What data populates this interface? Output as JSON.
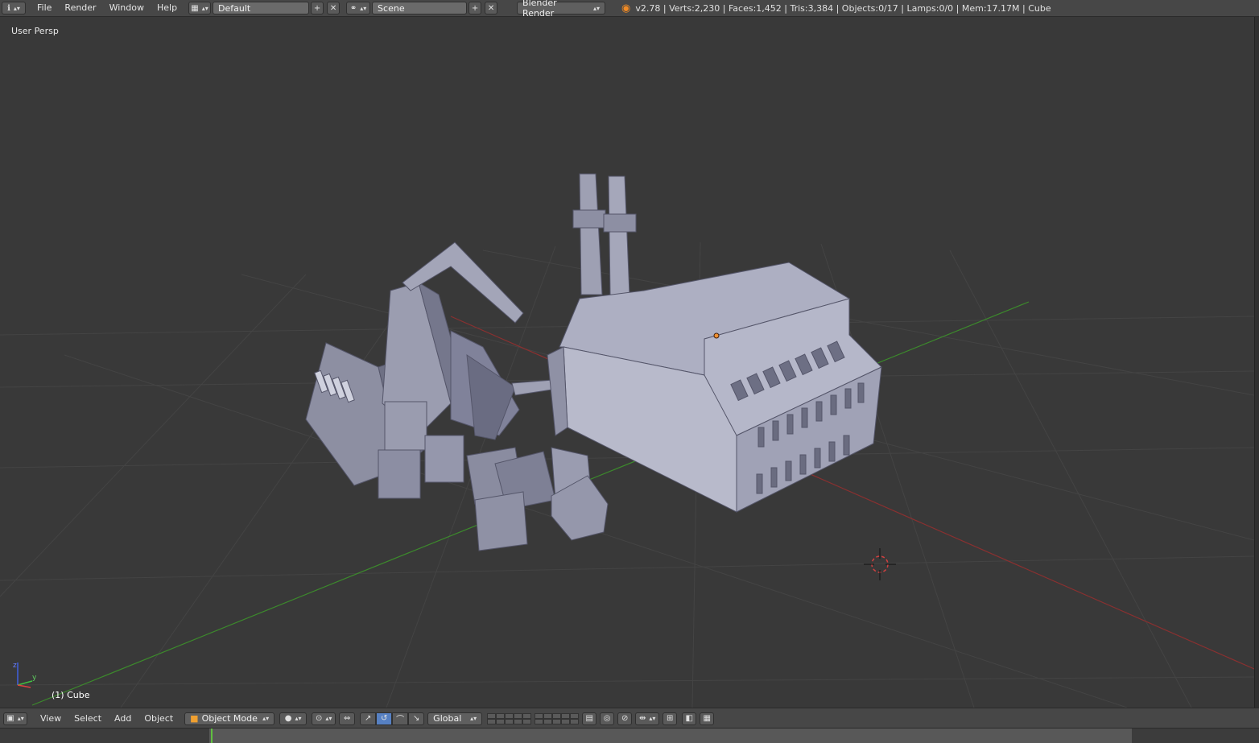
{
  "topbar": {
    "menus": [
      "File",
      "Render",
      "Window",
      "Help"
    ],
    "screen_layout": "Default",
    "scene": "Scene",
    "render_engine": "Blender Render",
    "stats": "v2.78 | Verts:2,230 | Faces:1,452 | Tris:3,384 | Objects:0/17 | Lamps:0/0 | Mem:17.17M | Cube"
  },
  "viewport": {
    "view_label": "User Persp",
    "object_label": "(1) Cube"
  },
  "bottombar": {
    "menus": [
      "View",
      "Select",
      "Add",
      "Object"
    ],
    "mode": "Object Mode",
    "orientation": "Global"
  },
  "colors": {
    "background": "#393939",
    "header": "#474747",
    "accent": "#5680c2",
    "x_axis": "#b03a3a",
    "y_axis": "#3aa03a",
    "mesh": "#a6a8ba"
  },
  "icons": [
    "info-icon",
    "screen-layout-icon",
    "scene-icon",
    "blender-logo-icon",
    "viewport-editor-icon",
    "object-mode-cube-icon",
    "solid-shading-icon",
    "pivot-icon",
    "manipulator-icon",
    "translate-icon",
    "rotate-icon",
    "scale-icon",
    "snap-icon",
    "render-icon",
    "axis-gizmo-icon",
    "3d-cursor-icon"
  ]
}
